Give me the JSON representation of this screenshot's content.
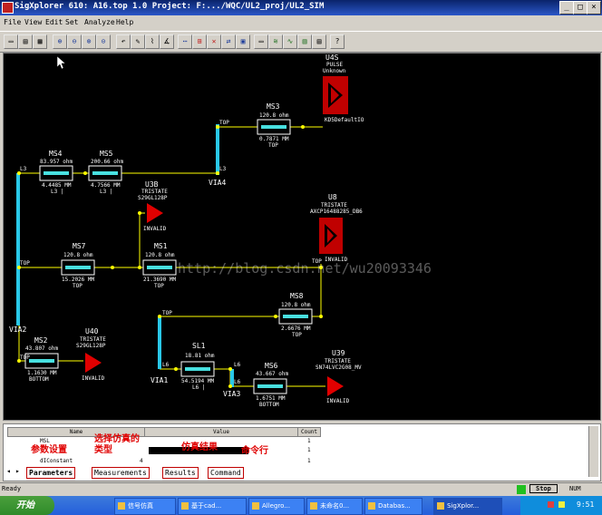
{
  "window": {
    "title": "SigXplorer 610: A16.top 1.0  Project: F:.../WQC/UL2_proj/UL2_SIM"
  },
  "menu": [
    "File",
    "View",
    "Edit",
    "Set",
    "Analyze",
    "Help"
  ],
  "toolbar_icons": [
    "new-icon",
    "open-icon",
    "save-icon",
    "zoom-in-icon",
    "zoom-out-icon",
    "zoom-fit-icon",
    "zoom-prev-icon",
    "undo-icon",
    "edit-icon",
    "route-icon",
    "measure-icon",
    "connect-icon",
    "add-part-icon",
    "delete-icon",
    "mirror-icon",
    "template-icon",
    "tline-icon",
    "graph-icon",
    "waveform-icon",
    "help-icon"
  ],
  "help_label": "?",
  "canvas": {
    "watermark": "http://blog.csdn.net/wu20093346",
    "transmission_lines": [
      {
        "name": "MS4",
        "imp": "83.957 ohm",
        "len": "4.4485 MM",
        "layer": "L3 |"
      },
      {
        "name": "MS5",
        "imp": "200.66 ohm",
        "len": "4.7566 MM",
        "layer": "L3 |"
      },
      {
        "name": "MS3",
        "imp": "120.8 ohm",
        "len": "0.7871 MM",
        "layer": "TOP"
      },
      {
        "name": "MS7",
        "imp": "120.8 ohm",
        "len": "15.2026 MM",
        "layer": "TOP"
      },
      {
        "name": "MS1",
        "imp": "120.8 ohm",
        "len": "21.3690 MM",
        "layer": "TOP"
      },
      {
        "name": "MS8",
        "imp": "120.8 ohm",
        "len": "2.6676 MM",
        "layer": "TOP"
      },
      {
        "name": "MS2",
        "imp": "43.807 ohm",
        "len": "1.1630 MM",
        "layer": "BOTTOM"
      },
      {
        "name": "SL1",
        "imp": "18.81 ohm",
        "len": "54.5194 MM",
        "layer": "L6 |"
      },
      {
        "name": "MS6",
        "imp": "43.667 ohm",
        "len": "1.6751 MM",
        "layer": "BOTTOM"
      }
    ],
    "vias": [
      "VIA4",
      "VIA2",
      "VIA1",
      "VIA3"
    ],
    "layer_tags": [
      "L3",
      "L3",
      "TOP",
      "TOP",
      "TOP",
      "TOP",
      "TOP",
      "L6",
      "L6",
      "L6"
    ],
    "drivers": [
      {
        "name": "U4S",
        "state": "PULSE",
        "model": "Unknown",
        "status": "KD5DefaultIO"
      },
      {
        "name": "U8",
        "state": "TRISTATE",
        "model": "AXCP16488285_DB6",
        "status": "INVALID"
      },
      {
        "name": "U3B",
        "state": "TRISTATE",
        "model": "S29GL128P",
        "status": "INVALID"
      },
      {
        "name": "U40",
        "state": "TRISTATE",
        "model": "S29GL128P",
        "status": "INVALID"
      },
      {
        "name": "U39",
        "state": "TRISTATE",
        "model": "SN74LVC2G08_MV",
        "status": "INVALID"
      }
    ]
  },
  "panel": {
    "col_name": "Name",
    "col_value": "Value",
    "col_count": "Count",
    "rows": [
      {
        "name": "MSL",
        "value": "",
        "count": "1"
      },
      {
        "name": "",
        "value": "",
        "count": "1"
      },
      {
        "name": "dIConstant",
        "value": "4",
        "count": "1"
      }
    ],
    "annotations": {
      "params": "参数设置",
      "sim_type": "选择仿真的\n类型",
      "results": "仿真结果",
      "cmd": "命令行"
    },
    "tabs": [
      "Parameters",
      "Measurements",
      "Results",
      "Command"
    ]
  },
  "status": {
    "text": "Ready",
    "stop_button": "Stop",
    "mode": "NUM"
  },
  "taskbar": {
    "start": "开始",
    "tasks": [
      "信号仿真",
      "基于cad...",
      "Allegro...",
      "未命名0...",
      "Databas...",
      "SigXplor..."
    ],
    "clock": "9:51"
  }
}
